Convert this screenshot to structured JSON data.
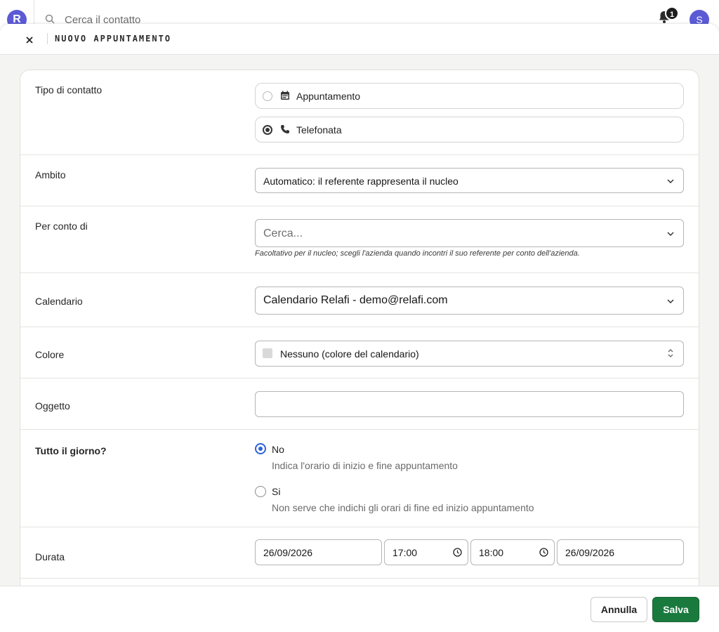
{
  "topbar": {
    "logo_text": "R",
    "search_placeholder": "Cerca il contatto",
    "notifications_count": "1",
    "user_initial": "S"
  },
  "modal": {
    "title": "NUOVO APPUNTAMENTO"
  },
  "form": {
    "contact_type": {
      "label": "Tipo di contatto",
      "options": [
        {
          "label": "Appuntamento",
          "icon": "calendar-icon",
          "selected": false
        },
        {
          "label": "Telefonata",
          "icon": "phone-icon",
          "selected": true
        }
      ]
    },
    "scope": {
      "label": "Ambito",
      "value": "Automatico: il referente rappresenta il nucleo"
    },
    "on_behalf": {
      "label": "Per conto di",
      "placeholder": "Cerca...",
      "help": "Facoltativo per il nucleo; scegli l'azienda quando incontri il suo referente per conto dell'azienda."
    },
    "calendar": {
      "label": "Calendario",
      "value": "Calendario Relafi - demo@relafi.com"
    },
    "color": {
      "label": "Colore",
      "value": "Nessuno (colore del calendario)",
      "swatch": "#d9d9d9"
    },
    "subject": {
      "label": "Oggetto",
      "value": ""
    },
    "all_day": {
      "label": "Tutto il giorno?",
      "options": [
        {
          "title": "No",
          "desc": "Indica l'orario di inizio e fine appuntamento",
          "selected": true
        },
        {
          "title": "Si",
          "desc": "Non serve che indichi gli orari di fine ed inizio appuntamento",
          "selected": false
        }
      ]
    },
    "duration": {
      "label": "Durata",
      "start_date": "26/09/2026",
      "start_time": "17:00",
      "end_time": "18:00",
      "end_date": "26/09/2026"
    }
  },
  "footer": {
    "cancel_label": "Annulla",
    "save_label": "Salva"
  },
  "colors": {
    "accent": "#5b5bd6",
    "save": "#1a7a3e",
    "radio_selected": "#2e62d9"
  }
}
